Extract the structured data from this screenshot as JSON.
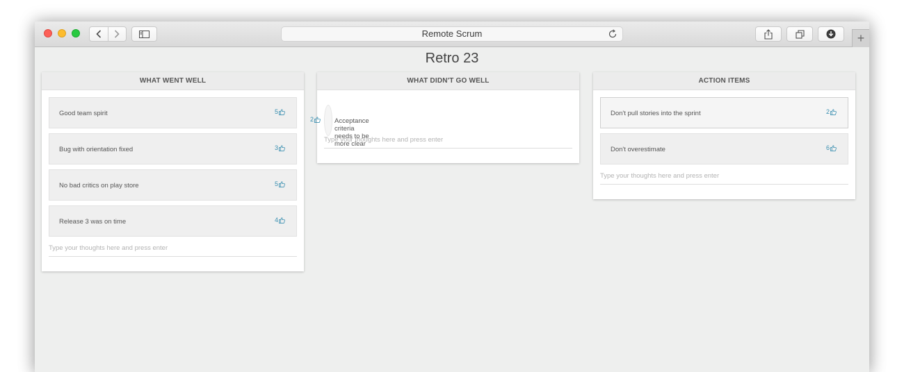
{
  "browser": {
    "address": "Remote Scrum",
    "newtab_label": "+"
  },
  "page": {
    "title": "Retro 23"
  },
  "columns": [
    {
      "title": "WHAT WENT WELL",
      "placeholder": "Type your thoughts here and press enter",
      "cards": [
        {
          "text": "Good team spirit",
          "votes": "5"
        },
        {
          "text": "Bug with orientation fixed",
          "votes": "3"
        },
        {
          "text": "No bad critics on play store",
          "votes": "5"
        },
        {
          "text": "Release 3 was on time",
          "votes": "4"
        }
      ]
    },
    {
      "title": "WHAT DIDN'T GO WELL",
      "placeholder": "Type your thoughts here and press enter",
      "cards": [
        {
          "text": "Acceptance criteria needs to be more clear",
          "votes": "2"
        }
      ]
    },
    {
      "title": "ACTION ITEMS",
      "placeholder": "Type your thoughts here and press enter",
      "cards": [
        {
          "text": "Don't pull stories into the sprint",
          "votes": "2"
        },
        {
          "text": "Don't overestimate",
          "votes": "6"
        }
      ]
    }
  ],
  "colors": {
    "vote_accent": "#3a8fb0",
    "page_background": "#eeefee"
  },
  "icons": {
    "vote": "thumbs-up-icon"
  }
}
